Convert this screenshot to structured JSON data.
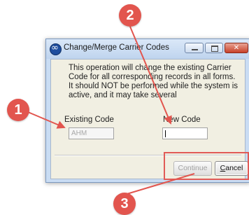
{
  "window": {
    "title": "Change/Merge Carrier Codes",
    "message": "This operation will change the existing Carrier Code for all corresponding records in all forms. It should NOT be performed while the system is active, and it may take several",
    "existing_label": "Existing Code",
    "existing_value": "AHM",
    "new_label": "New Code",
    "new_value": "",
    "continue_label": "Continue",
    "cancel_rest": "ancel",
    "cancel_mnemonic": "C"
  },
  "callouts": [
    "1",
    "2",
    "3"
  ],
  "colors": {
    "callout": "#e2554e",
    "title_bar": "#c9dcf3",
    "client_bg": "#f1efe2"
  },
  "icons": {
    "app": "app-logo-icon",
    "min": "minimize-icon",
    "max": "maximize-icon",
    "close": "close-icon"
  }
}
